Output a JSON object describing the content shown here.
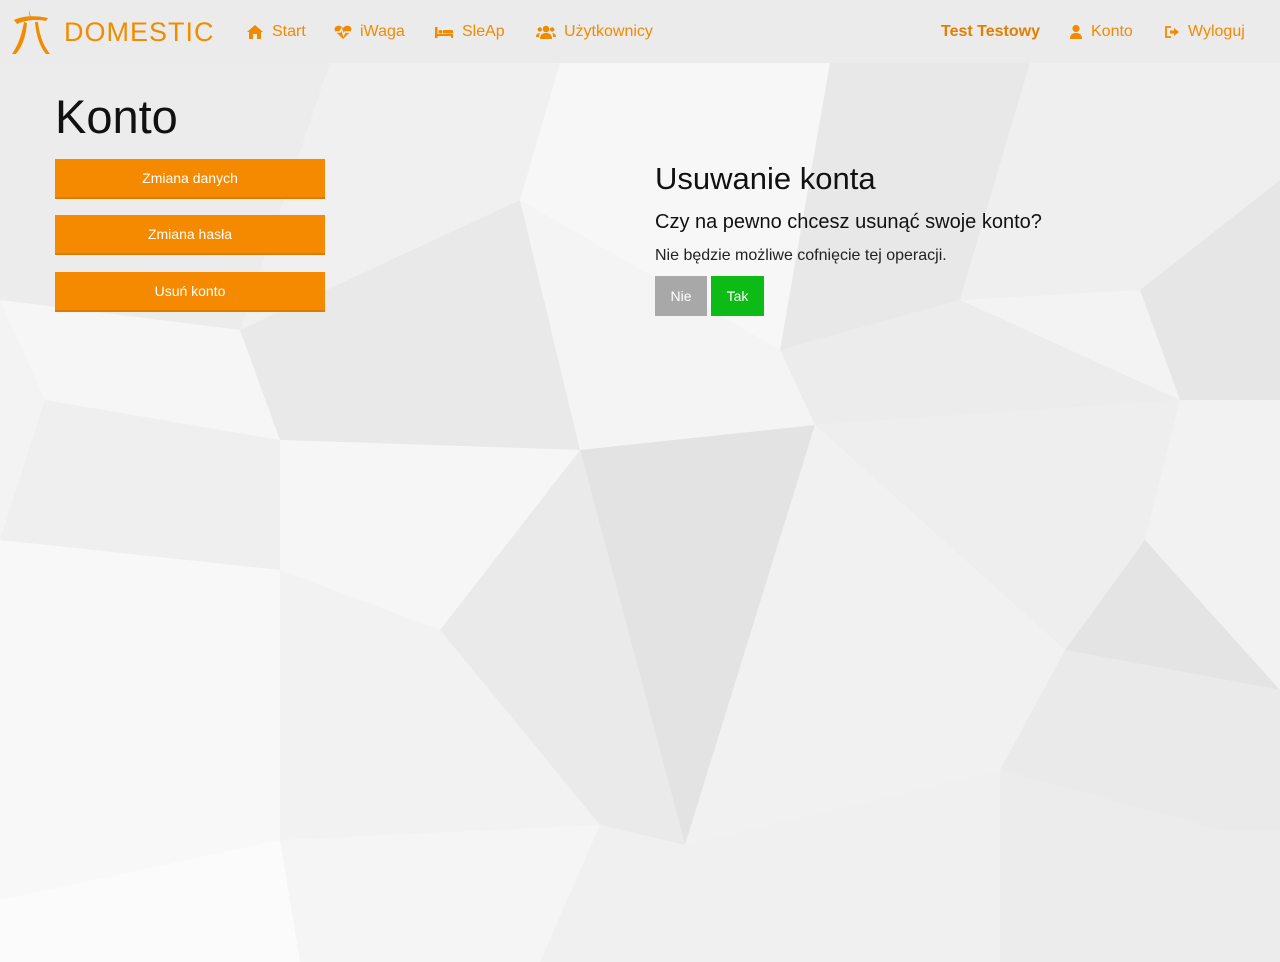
{
  "brand": {
    "name": "DOMESTIC",
    "logo_icon": "dancer-logo-icon"
  },
  "nav": {
    "items": [
      {
        "label": "Start",
        "icon": "home-icon"
      },
      {
        "label": "iWaga",
        "icon": "heartbeat-icon"
      },
      {
        "label": "SleAp",
        "icon": "bed-icon"
      },
      {
        "label": "Użytkownicy",
        "icon": "users-icon"
      }
    ],
    "user_name": "Test Testowy",
    "account": {
      "label": "Konto",
      "icon": "user-icon"
    },
    "logout": {
      "label": "Wyloguj",
      "icon": "sign-out-icon"
    }
  },
  "page": {
    "title": "Konto",
    "menu": [
      {
        "label": "Zmiana danych"
      },
      {
        "label": "Zmiana hasła"
      },
      {
        "label": "Usuń konto"
      }
    ]
  },
  "delete_panel": {
    "title": "Usuwanie konta",
    "question": "Czy na pewno chcesz usunąć swoje konto?",
    "warning": "Nie będzie możliwe cofnięcie tej operacji.",
    "no_label": "Nie",
    "yes_label": "Tak"
  },
  "colors": {
    "accent": "#f58a00",
    "confirm": "#0cbb16",
    "cancel": "#a8a8a8",
    "navbar": "#ebebeb"
  }
}
